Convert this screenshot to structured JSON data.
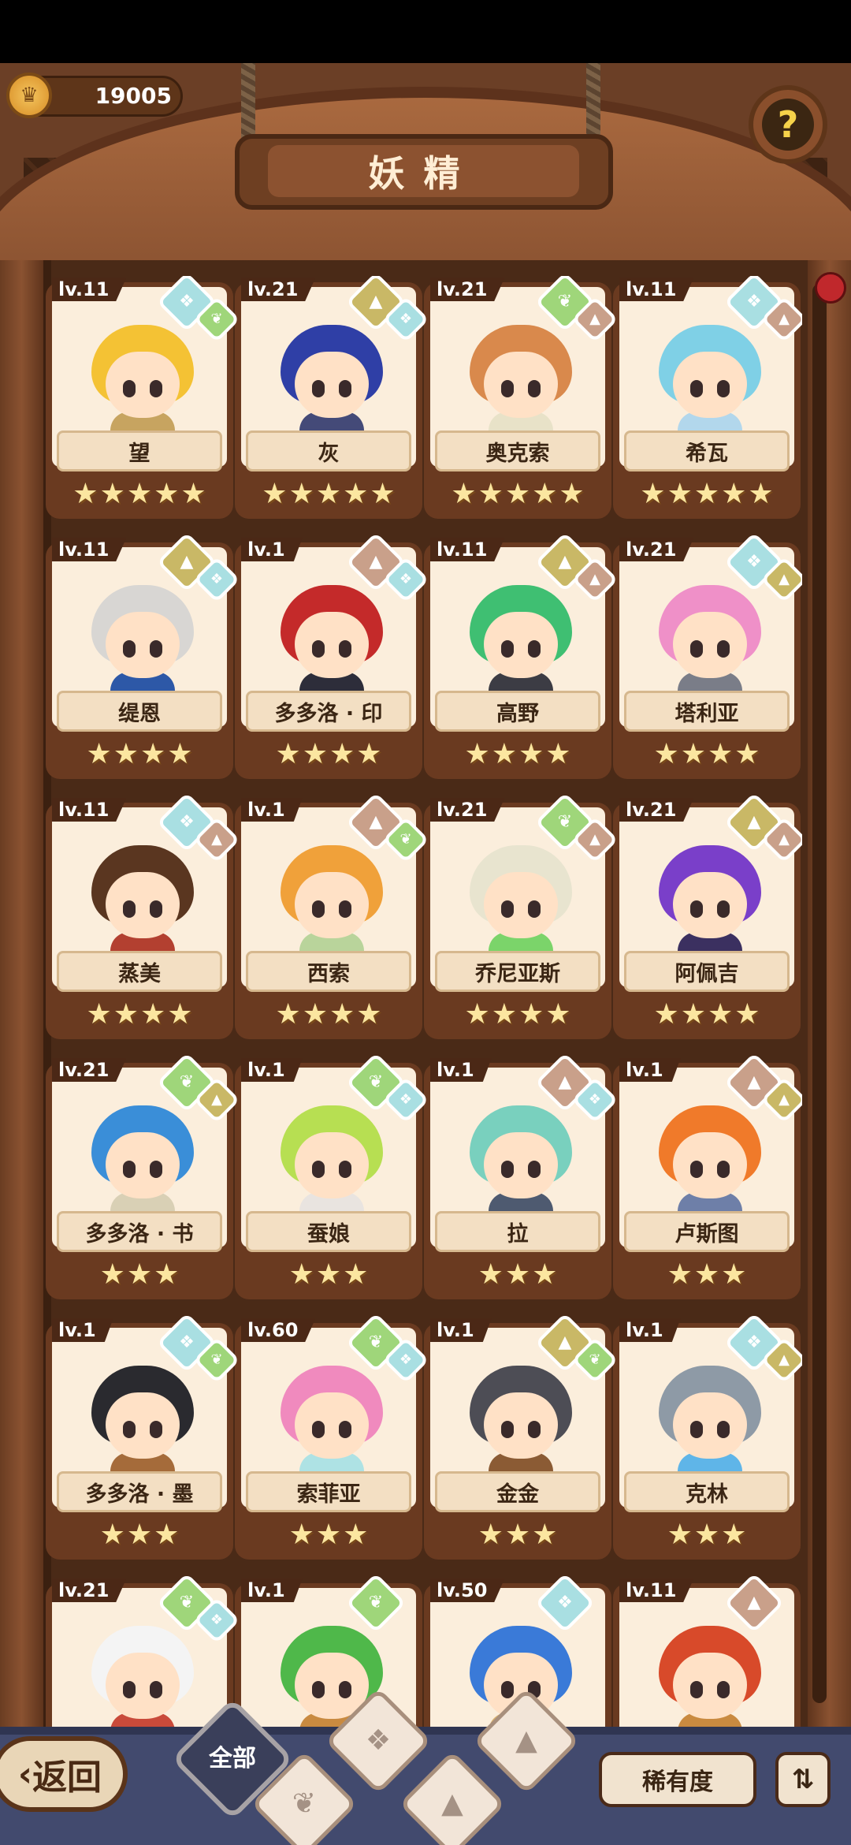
{
  "currency": {
    "value": "19005",
    "icon": "crown-coin-icon"
  },
  "header": {
    "title": "妖精",
    "help_icon": "question-sprout-icon"
  },
  "cards": [
    {
      "level": "lv.11",
      "name": "望",
      "stars": 5,
      "elements": [
        "water",
        "plant"
      ],
      "hair": "#f4c234",
      "outfit": "#c7a460"
    },
    {
      "level": "lv.21",
      "name": "灰",
      "stars": 5,
      "elements": [
        "earth",
        "water"
      ],
      "hair": "#2f3fa6",
      "outfit": "#444a78"
    },
    {
      "level": "lv.21",
      "name": "奥克索",
      "stars": 5,
      "elements": [
        "plant",
        "fire"
      ],
      "hair": "#d9894c",
      "outfit": "#e8e2c8"
    },
    {
      "level": "lv.11",
      "name": "希瓦",
      "stars": 5,
      "elements": [
        "water",
        "fire"
      ],
      "hair": "#7fd0e6",
      "outfit": "#b2d7ec"
    },
    {
      "level": "lv.11",
      "name": "缇恩",
      "stars": 4,
      "elements": [
        "earth",
        "water"
      ],
      "hair": "#d8d6d3",
      "outfit": "#2d58a7"
    },
    {
      "level": "lv.1",
      "name": "多多洛 · 印",
      "stars": 4,
      "elements": [
        "fire",
        "water"
      ],
      "hair": "#c42a2a",
      "outfit": "#2d2d3a"
    },
    {
      "level": "lv.11",
      "name": "高野",
      "stars": 4,
      "elements": [
        "earth",
        "fire"
      ],
      "hair": "#3fbf72",
      "outfit": "#3c3c44"
    },
    {
      "level": "lv.21",
      "name": "塔利亚",
      "stars": 4,
      "elements": [
        "water",
        "earth"
      ],
      "hair": "#ef90c8",
      "outfit": "#7a7d88"
    },
    {
      "level": "lv.11",
      "name": "蒸美",
      "stars": 4,
      "elements": [
        "water",
        "fire"
      ],
      "hair": "#5a3620",
      "outfit": "#b34030"
    },
    {
      "level": "lv.1",
      "name": "西索",
      "stars": 4,
      "elements": [
        "fire",
        "plant"
      ],
      "hair": "#f0a13a",
      "outfit": "#b9d49b"
    },
    {
      "level": "lv.21",
      "name": "乔尼亚斯",
      "stars": 4,
      "elements": [
        "plant",
        "fire"
      ],
      "hair": "#e8e4cf",
      "outfit": "#7bd46a"
    },
    {
      "level": "lv.21",
      "name": "阿佩吉",
      "stars": 4,
      "elements": [
        "earth",
        "fire"
      ],
      "hair": "#7a3fc9",
      "outfit": "#3b3060"
    },
    {
      "level": "lv.21",
      "name": "多多洛 · 书",
      "stars": 3,
      "elements": [
        "plant",
        "earth"
      ],
      "hair": "#3a8ed8",
      "outfit": "#d9d0b5"
    },
    {
      "level": "lv.1",
      "name": "蚕娘",
      "stars": 3,
      "elements": [
        "plant",
        "water"
      ],
      "hair": "#b7df52",
      "outfit": "#e9e4e0"
    },
    {
      "level": "lv.1",
      "name": "拉",
      "stars": 3,
      "elements": [
        "fire",
        "water"
      ],
      "hair": "#79d0be",
      "outfit": "#4e5a70"
    },
    {
      "level": "lv.1",
      "name": "卢斯图",
      "stars": 3,
      "elements": [
        "fire",
        "earth"
      ],
      "hair": "#f07a2a",
      "outfit": "#6e7fa8"
    },
    {
      "level": "lv.1",
      "name": "多多洛 · 墨",
      "stars": 3,
      "elements": [
        "water",
        "plant"
      ],
      "hair": "#2a2a2f",
      "outfit": "#a56b3a"
    },
    {
      "level": "lv.60",
      "name": "索菲亚",
      "stars": 3,
      "elements": [
        "plant",
        "water"
      ],
      "hair": "#f08abe",
      "outfit": "#aee2e4"
    },
    {
      "level": "lv.1",
      "name": "金金",
      "stars": 3,
      "elements": [
        "earth",
        "plant"
      ],
      "hair": "#4d4d55",
      "outfit": "#8b5b34"
    },
    {
      "level": "lv.1",
      "name": "克林",
      "stars": 3,
      "elements": [
        "water",
        "earth"
      ],
      "hair": "#8e9aa6",
      "outfit": "#5fb5e8"
    },
    {
      "level": "lv.21",
      "name": "",
      "stars": 0,
      "elements": [
        "plant",
        "water"
      ],
      "hair": "#f4f4f4",
      "outfit": "#c94a3a"
    },
    {
      "level": "lv.1",
      "name": "",
      "stars": 0,
      "elements": [
        "plant"
      ],
      "hair": "#4fb84a",
      "outfit": "#c98a40"
    },
    {
      "level": "lv.50",
      "name": "",
      "stars": 0,
      "elements": [
        "water"
      ],
      "hair": "#3a7ad8",
      "outfit": "#d8b070"
    },
    {
      "level": "lv.11",
      "name": "",
      "stars": 0,
      "elements": [
        "fire"
      ],
      "hair": "#d84a2a",
      "outfit": "#c98a40"
    }
  ],
  "bottom": {
    "back_label": "返回",
    "filter_all_label": "全部",
    "filters": [
      "plant",
      "water",
      "earth",
      "fire"
    ],
    "sort_label": "稀有度",
    "order_icon": "sort-order-icon"
  },
  "colors": {
    "water": "#a9dfe2",
    "earth": "#c9b866",
    "plant": "#9fd67a",
    "fire": "#c9a08a",
    "wood": "#6b3f26"
  }
}
